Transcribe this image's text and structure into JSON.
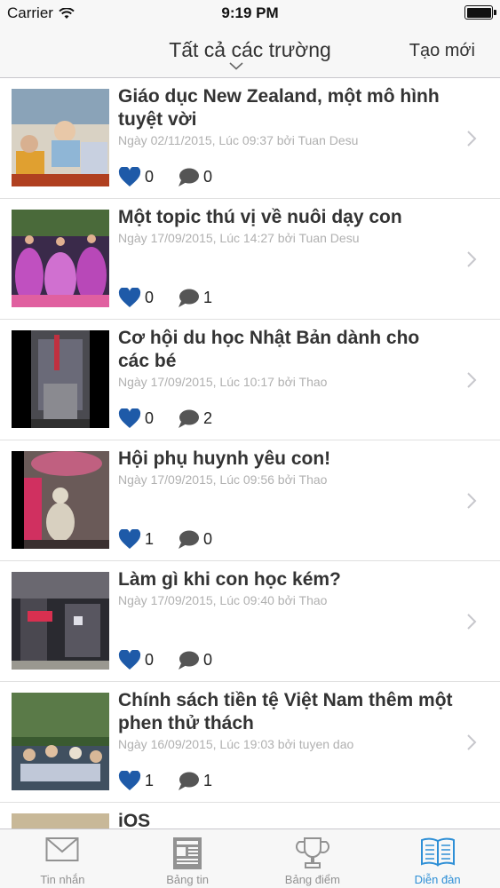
{
  "status": {
    "carrier": "Carrier",
    "time": "9:19 PM"
  },
  "header": {
    "title": "Tất cả các trường",
    "action": "Tạo mới"
  },
  "posts": [
    {
      "title": "Giáo dục New Zealand, một mô hình tuyệt vời",
      "meta": "Ngày 02/11/2015, Lúc 09:37 bởi Tuan Desu",
      "likes": "0",
      "comments": "0"
    },
    {
      "title": "Một topic thú vị về nuôi dạy con",
      "meta": "Ngày 17/09/2015, Lúc 14:27 bởi Tuan Desu",
      "likes": "0",
      "comments": "1"
    },
    {
      "title": "Cơ hội du học Nhật Bản dành cho các bé",
      "meta": "Ngày 17/09/2015, Lúc 10:17 bởi Thao",
      "likes": "0",
      "comments": "2"
    },
    {
      "title": "Hội phụ huynh yêu con!",
      "meta": "Ngày 17/09/2015, Lúc 09:56 bởi Thao",
      "likes": "1",
      "comments": "0"
    },
    {
      "title": "Làm gì khi con học kém?",
      "meta": "Ngày 17/09/2015, Lúc 09:40 bởi Thao",
      "likes": "0",
      "comments": "0"
    },
    {
      "title": "Chính sách tiền tệ Việt Nam thêm một phen thử thách",
      "meta": "Ngày 16/09/2015, Lúc 19:03 bởi tuyen dao",
      "likes": "1",
      "comments": "1"
    },
    {
      "title": "iOS",
      "meta": "",
      "likes": "",
      "comments": ""
    }
  ],
  "tabs": [
    {
      "label": "Tin nhắn",
      "icon": "envelope-icon"
    },
    {
      "label": "Bảng tin",
      "icon": "newspaper-icon"
    },
    {
      "label": "Bảng điểm",
      "icon": "trophy-icon"
    },
    {
      "label": "Diễn đàn",
      "icon": "book-icon"
    }
  ],
  "colors": {
    "accent": "#2e8fd6",
    "heart": "#1e5aa8",
    "bubble": "#555555"
  }
}
